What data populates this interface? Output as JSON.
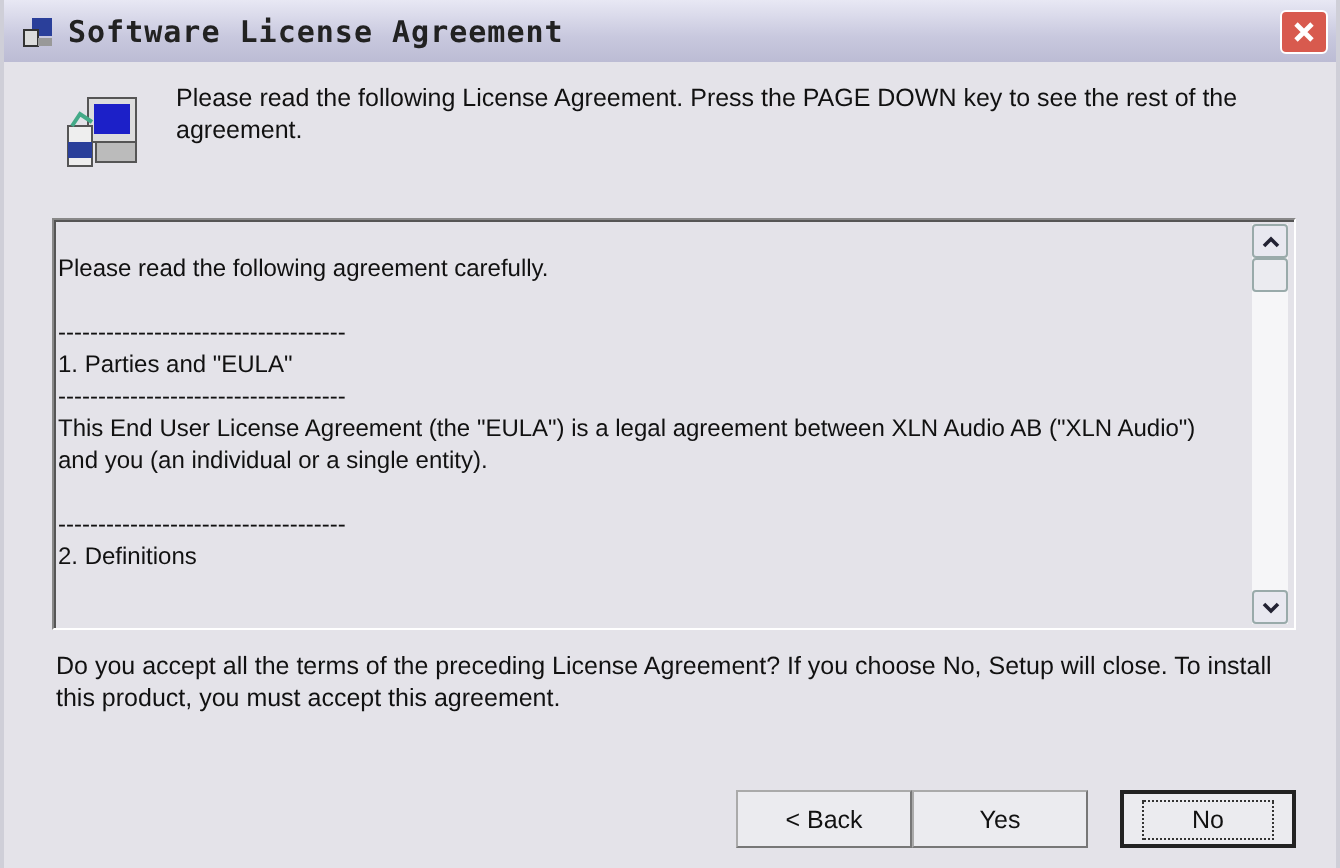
{
  "window": {
    "title": "Software License Agreement"
  },
  "header": {
    "text": "Please read the following License Agreement. Press the PAGE DOWN key to see the rest of the agreement."
  },
  "license_text": [
    [
      "Please read the following agreement carefully."
    ],
    [
      "------------------------------------",
      "1. Parties and \"EULA\"",
      "------------------------------------",
      "This End User License Agreement (the \"EULA\") is a legal agreement between XLN Audio AB (\"XLN Audio\") and you (an individual or a single entity)."
    ],
    [
      "------------------------------------",
      "2. Definitions"
    ]
  ],
  "question": "Do you accept all the terms of the preceding License Agreement? If you choose No, Setup will close. To install this product, you must accept this agreement.",
  "buttons": [
    {
      "label": "< Back",
      "default": false
    },
    {
      "label": "Yes",
      "default": false
    },
    {
      "label": "No",
      "default": true
    }
  ]
}
